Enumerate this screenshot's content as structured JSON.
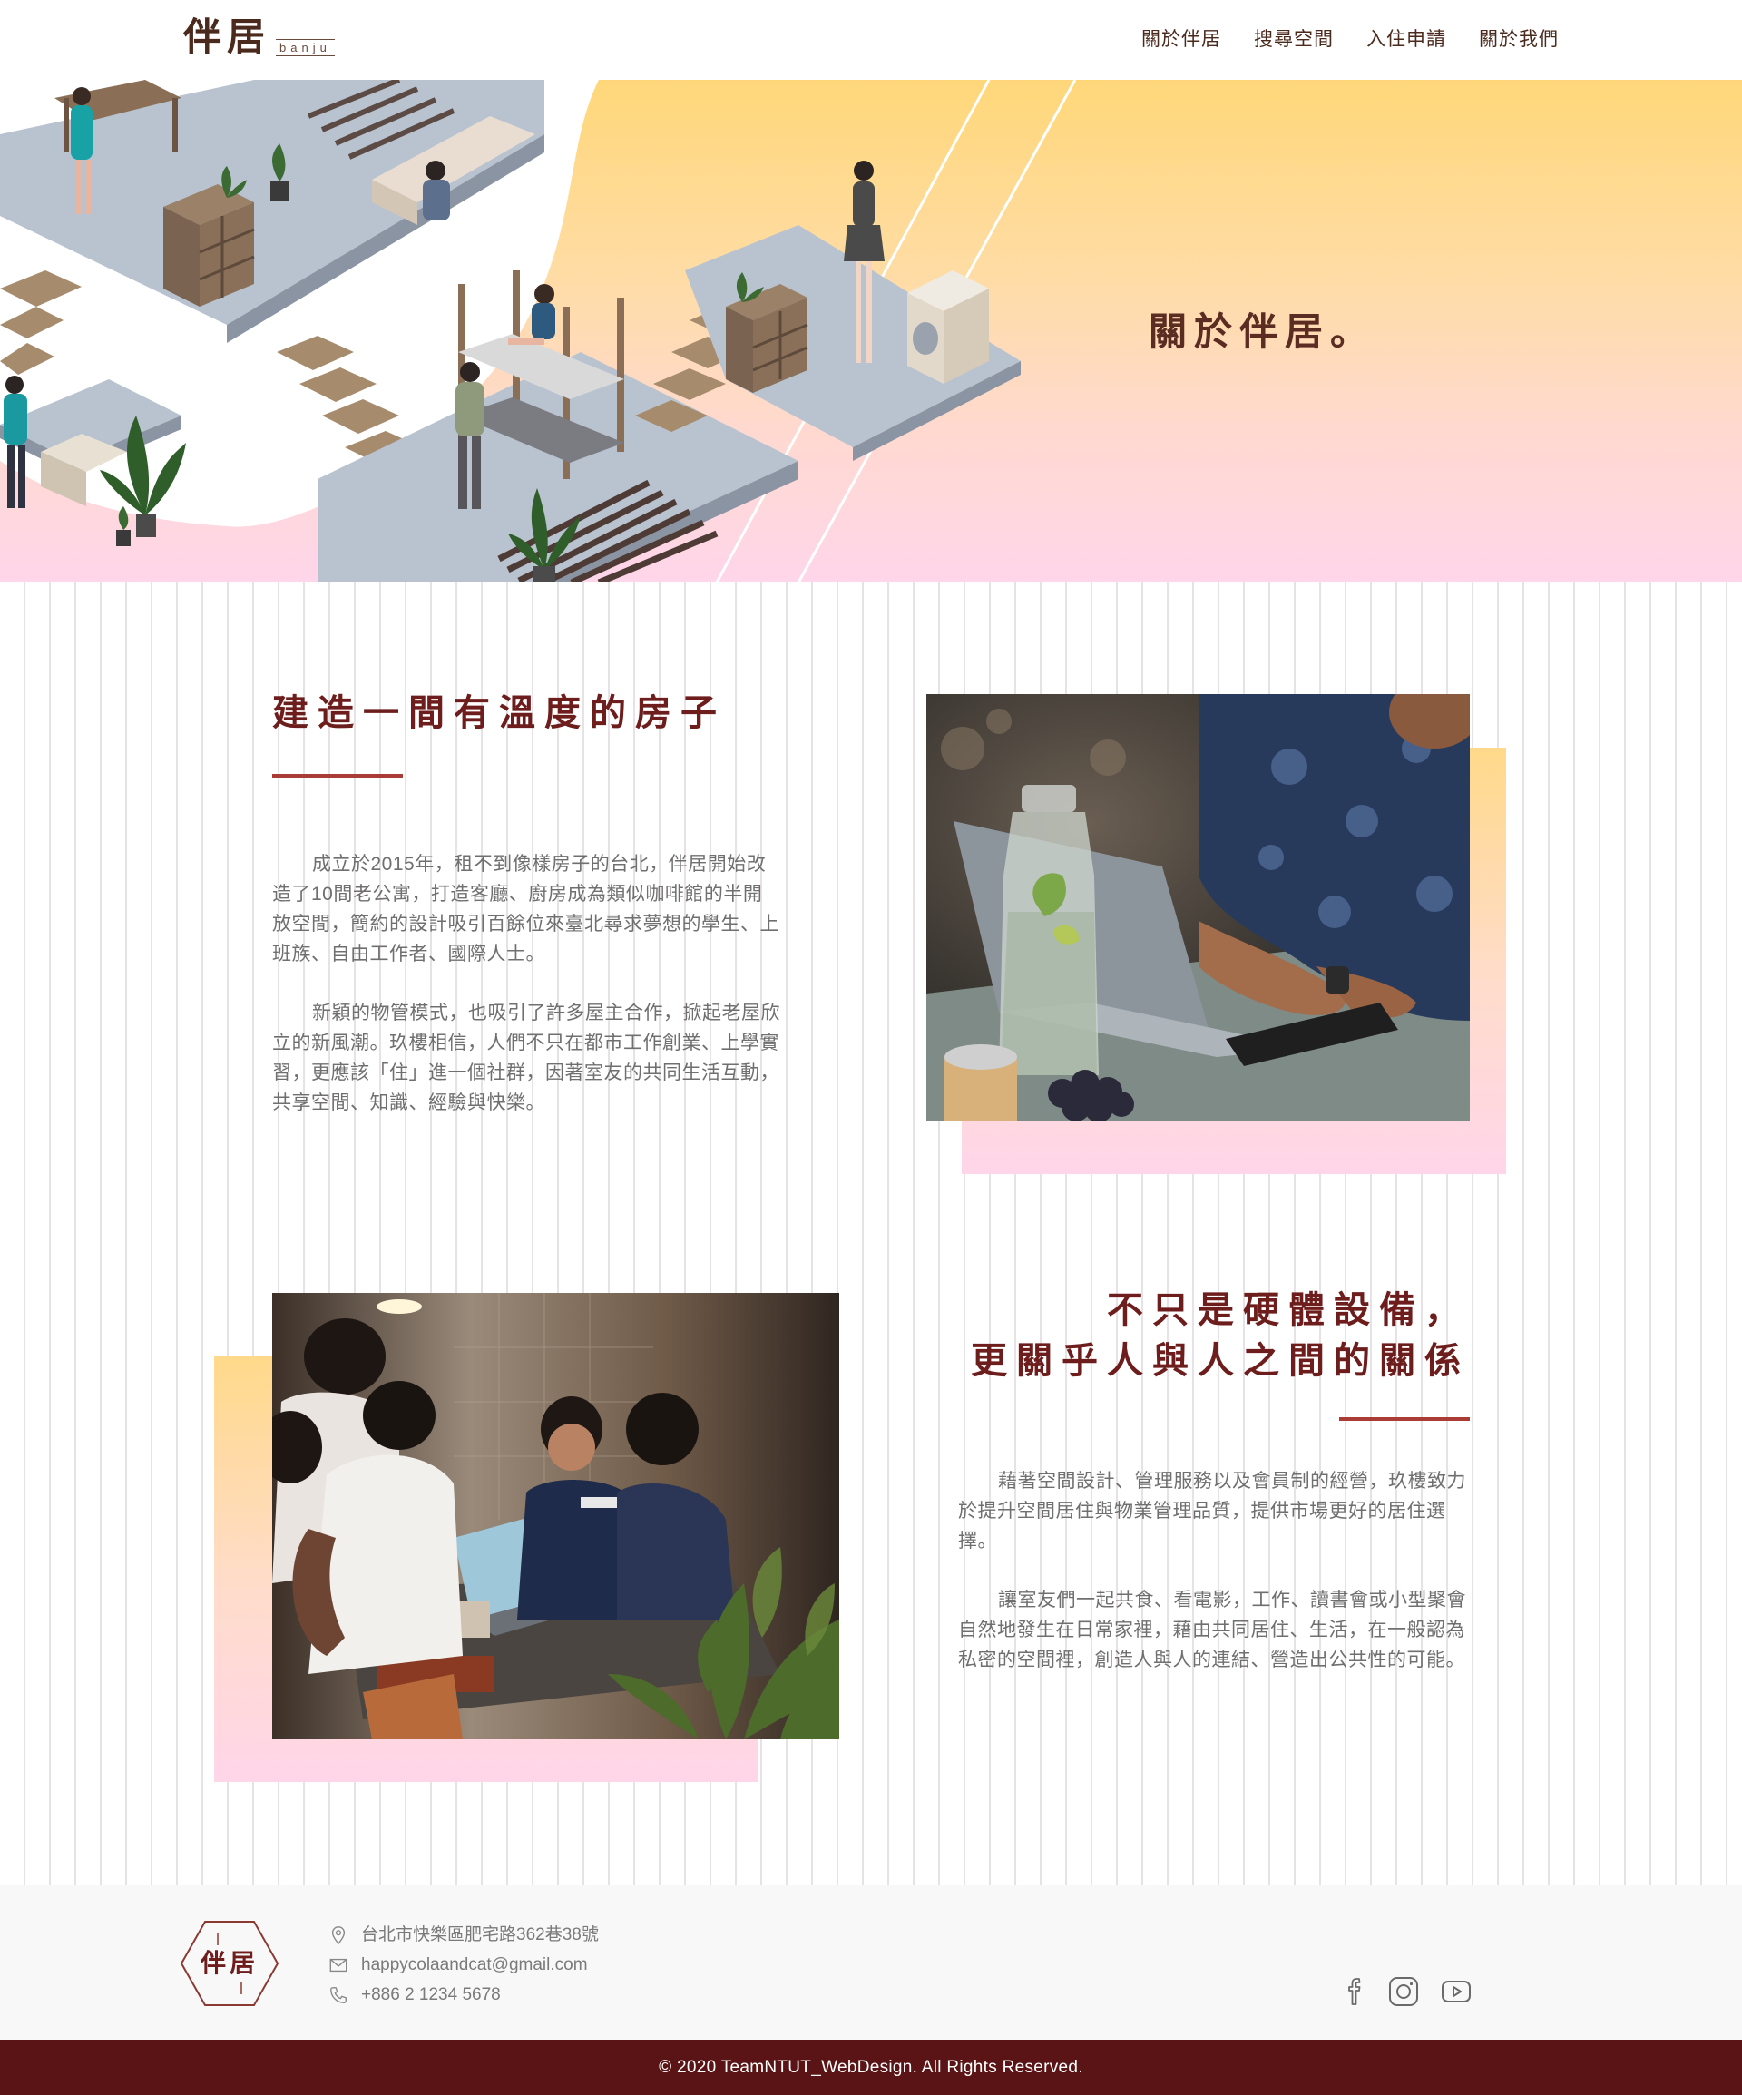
{
  "header": {
    "logo_main": "伴居",
    "logo_sub": "banju",
    "nav": [
      "關於伴居",
      "搜尋空間",
      "入住申請",
      "關於我們"
    ]
  },
  "hero": {
    "title": "關於伴居。",
    "illustration": "isometric-shared-apartment-illustration"
  },
  "section1": {
    "title": "建造一間有溫度的房子",
    "paragraphs": [
      "成立於2015年，租不到像樣房子的台北，伴居開始改造了10間老公寓，打造客廳、廚房成為類似咖啡館的半開放空間，簡約的設計吸引百餘位來臺北尋求夢想的學生、上班族、自由工作者、國際人士。",
      "新穎的物管模式，也吸引了許多屋主合作，掀起老屋欣立的新風潮。玖樓相信，人們不只在都市工作創業、上學實習，更應該「住」進一個社群，因著室友的共同生活互動，共享空間、知識、經驗與快樂。"
    ],
    "photo": "person-working-on-laptop-photo"
  },
  "section2": {
    "title_line1": "不只是硬體設備，",
    "title_line2": "更關乎人與人之間的關係",
    "paragraphs": [
      "藉著空間設計、管理服務以及會員制的經營，玖樓致力於提升空間居住與物業管理品質，提供市場更好的居住選擇。",
      "讓室友們一起共食、看電影，工作、讀書會或小型聚會自然地發生在日常家裡，藉由共同居住、生活，在一般認為私密的空間裡，創造人與人的連結、營造出公共性的可能。"
    ],
    "photo": "group-gathering-around-table-photo"
  },
  "footer": {
    "logo_text": "伴居",
    "address": "台北市快樂區肥宅路362巷38號",
    "email": "happycolaandcat@gmail.com",
    "phone": "+886 2 1234 5678",
    "social": [
      "facebook-icon",
      "instagram-icon",
      "youtube-icon"
    ],
    "copyright": "© 2020 TeamNTUT_WebDesign. All Rights Reserved."
  },
  "colors": {
    "brand_dark": "#4b2a1e",
    "title_red": "#6e1d1d",
    "rule_red": "#a93d36",
    "footer_bar": "#5b1416",
    "hero_top": "#ffd77a",
    "hero_bottom": "#ffd6ea"
  }
}
